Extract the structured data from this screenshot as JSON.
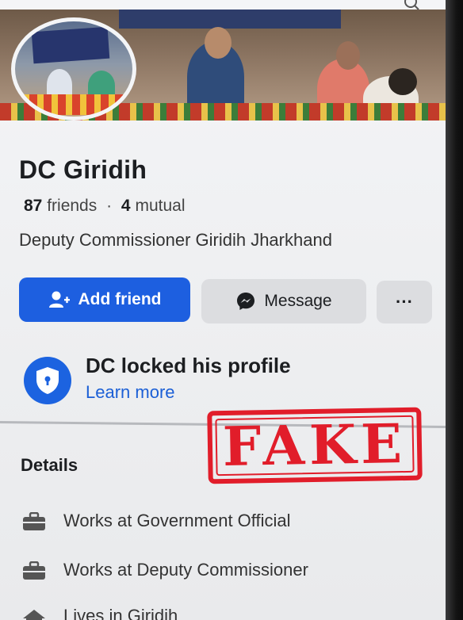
{
  "profile": {
    "name": "DC Giridih",
    "friends_count": "87",
    "friends_label": "friends",
    "mutual_count": "4",
    "mutual_label": "mutual",
    "separator": "·",
    "bio": "Deputy Commissioner Giridih Jharkhand"
  },
  "actions": {
    "add_friend": "Add friend",
    "message": "Message",
    "more": "···"
  },
  "locked": {
    "title": "DC locked his profile",
    "link": "Learn more"
  },
  "details": {
    "heading": "Details",
    "items": [
      {
        "icon": "briefcase-icon",
        "text": "Works at Government Official"
      },
      {
        "icon": "briefcase-icon",
        "text": "Works at Deputy Commissioner"
      },
      {
        "icon": "home-icon",
        "text": "Lives in Giridih"
      }
    ]
  },
  "stamp": {
    "text": "FAKE",
    "color": "#e11d2a"
  },
  "colors": {
    "accent": "#1d5fe0",
    "link": "#1b5fd6"
  }
}
